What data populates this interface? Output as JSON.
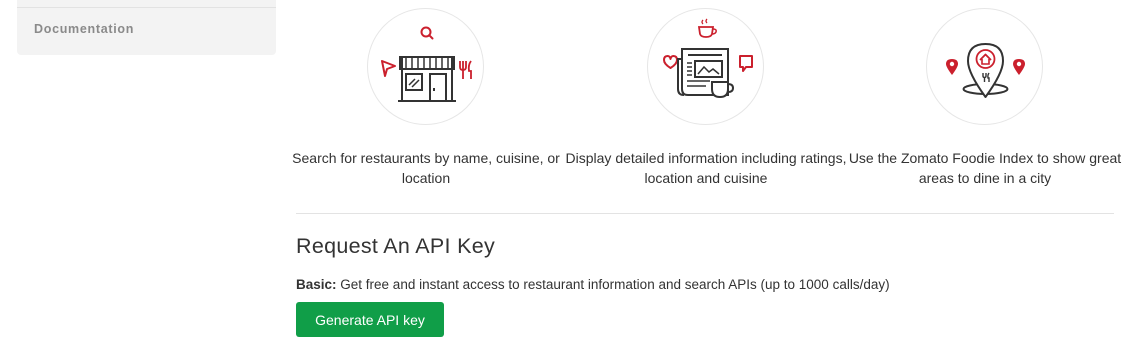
{
  "sidebar": {
    "items": [
      {
        "label": "Documentation"
      }
    ]
  },
  "features": [
    {
      "icon": "restaurant-search-icon",
      "description": "Search for restaurants by name, cuisine, or location"
    },
    {
      "icon": "restaurant-info-icon",
      "description": "Display detailed information including ratings, location and cuisine"
    },
    {
      "icon": "foodie-index-map-icon",
      "description": "Use the Zomato Foodie Index to show great areas to dine in a city"
    }
  ],
  "api_key": {
    "title": "Request An API Key",
    "basic_label": "Basic:",
    "basic_text": " Get free and instant access to restaurant information and search APIs (up to 1000 calls/day)",
    "button_label": "Generate API key"
  },
  "colors": {
    "accent_red": "#cb202d",
    "icon_dark": "#333333",
    "button_green": "#109e48"
  }
}
